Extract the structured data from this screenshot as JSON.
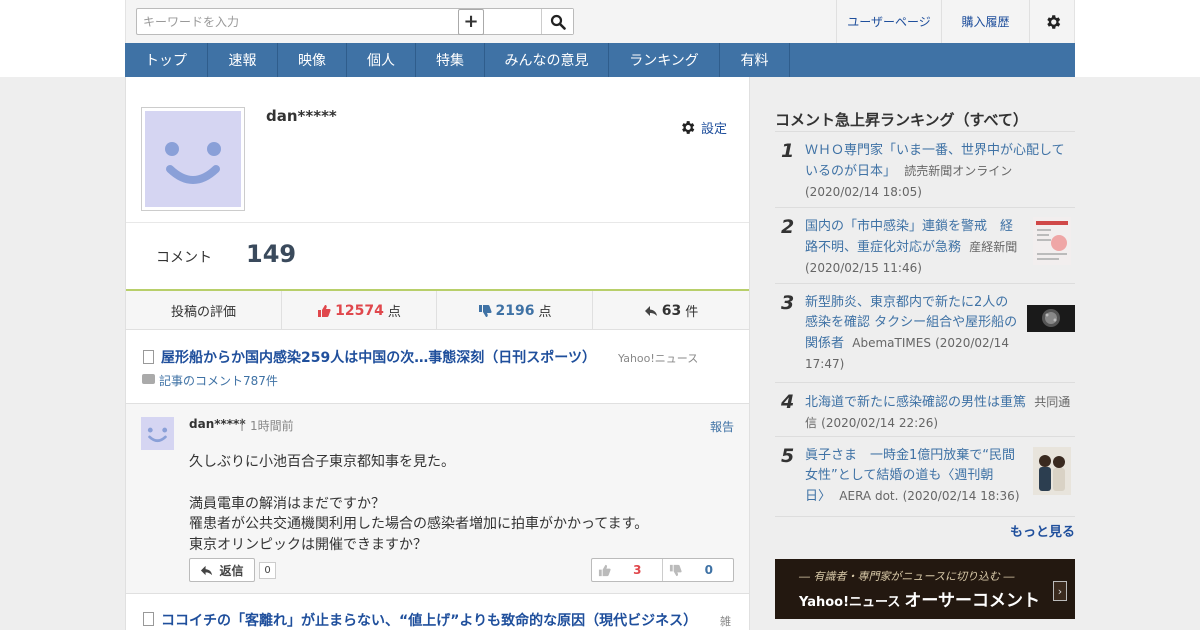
{
  "header": {
    "search_placeholder": "キーワードを入力",
    "user_page": "ユーザーページ",
    "purchase_history": "購入履歴"
  },
  "nav": [
    "トップ",
    "速報",
    "映像",
    "個人",
    "特集",
    "みんなの意見",
    "ランキング",
    "有料"
  ],
  "profile": {
    "username": "dan*****",
    "settings_label": "設定",
    "comment_label": "コメント",
    "comment_count": "149"
  },
  "stats": {
    "label": "投稿の評価",
    "likes": "12574",
    "likes_unit": "点",
    "dislikes": "2196",
    "dislikes_unit": "点",
    "replies": "63",
    "replies_unit": "件"
  },
  "article1": {
    "title": "屋形船からか国内感染259人は中国の次…事態深刻（日刊スポーツ）",
    "source": "Yahoo!ニュース",
    "comments_link": "記事のコメント787件"
  },
  "comment": {
    "user": "dan*****",
    "separator": "|",
    "time": "1時間前",
    "report": "報告",
    "lines": [
      "久しぶりに小池百合子東京都知事を見た。",
      "",
      "満員電車の解消はまだですか？",
      "罹患者が公共交通機関利用した場合の感染者増加に拍車がかかってます。",
      "東京オリンピックは開催できますか？"
    ],
    "reply_label": "返信",
    "reply_count": "0",
    "likes": "3",
    "dislikes": "0"
  },
  "article2": {
    "title": "ココイチの「客離れ」が止まらない、“値上げ”よりも致命的な原因（現代ビジネス）",
    "source": "雑"
  },
  "sidebar": {
    "title": "コメント急上昇ランキング（すべて）",
    "items": [
      {
        "rank": "1",
        "title": "ＷＨＯ専門家「いま一番、世界中が心配しているのが日本」",
        "source": "読売新聞オンライン",
        "date": "(2020/02/14 18:05)"
      },
      {
        "rank": "2",
        "title": "国内の「市中感染」連鎖を警戒　経路不明、重症化対応が急務",
        "source": "産経新聞",
        "date": "(2020/02/15 11:46)"
      },
      {
        "rank": "3",
        "title": "新型肺炎、東京都内で新たに2人の感染を確認 タクシー組合や屋形船の関係者",
        "source": "AbemaTIMES",
        "date": "(2020/02/14 17:47)"
      },
      {
        "rank": "4",
        "title": "北海道で新たに感染確認の男性は重篤",
        "source": "共同通信",
        "date": "(2020/02/14 22:26)"
      },
      {
        "rank": "5",
        "title": "眞子さま　一時金1億円放棄で“民間女性”として結婚の道も〈週刊朝日〉",
        "source": "AERA dot.",
        "date": "(2020/02/14 18:36)"
      }
    ],
    "more": "もっと見る",
    "banner_sub": "― 有識者・専門家がニュースに切り込む ―",
    "banner_yahoo": "Yahoo!ニュース",
    "banner_main": "オーサーコメント"
  }
}
